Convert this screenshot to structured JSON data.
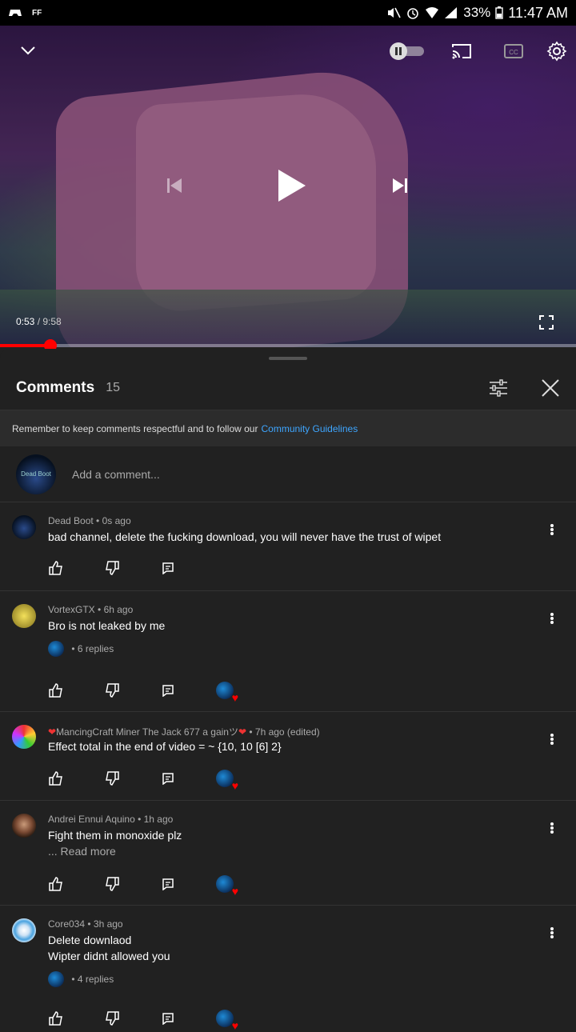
{
  "status_bar": {
    "left_text": "FF",
    "battery": "33%",
    "time": "11:47 AM"
  },
  "player": {
    "time_current": "0:53",
    "time_separator": " / ",
    "time_total": "9:58",
    "progress_fraction": 0.088,
    "accent_color": "#ff0000"
  },
  "comments_panel": {
    "title": "Comments",
    "count": "15",
    "notice_text": "Remember to keep comments respectful and to follow our",
    "notice_link": "Community Guidelines",
    "add_placeholder": "Add a comment...",
    "my_avatar_text": "Dead Boot",
    "link_color": "#3ea6ff"
  },
  "comments": [
    {
      "author": "Dead Boot",
      "age": "0s ago",
      "text": "bad channel, delete the fucking download, you will never have the trust of wipet"
    },
    {
      "author": "VortexGTX",
      "age": "6h ago",
      "text": "Bro is not leaked by me",
      "replies": "6 replies"
    },
    {
      "author_prefix": "❤",
      "author": "MancingCraft Miner The Jack 677 a gainツ",
      "author_suffix": "❤",
      "age": "7h ago (edited)",
      "text": "Effect total in the end of video = ~ {10, 10 [6] 2}"
    },
    {
      "author": "Andrei Ennui Aquino",
      "age": "1h ago",
      "text": "Fight them in monoxide plz",
      "more": "... Read more"
    },
    {
      "author": "Core034",
      "age": "3h ago",
      "text": "Delete downlaod",
      "text2": "Wipter didnt allowed you",
      "replies": "4 replies"
    }
  ],
  "separator": " • "
}
